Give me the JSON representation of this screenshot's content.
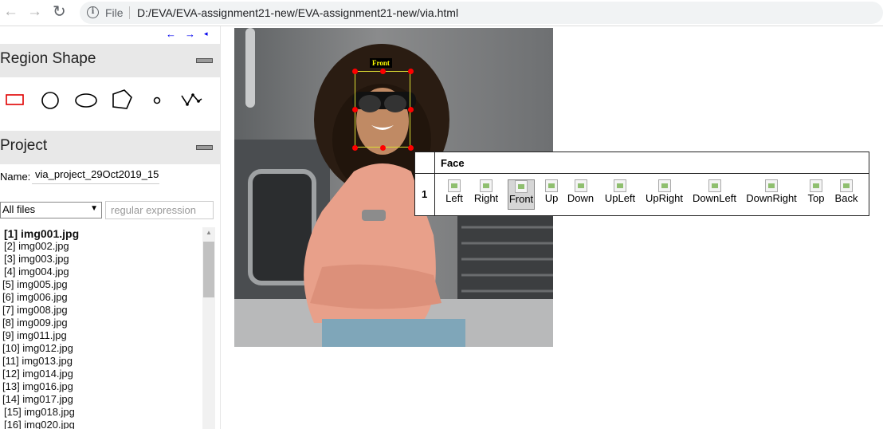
{
  "browser": {
    "file_label": "File",
    "url": "D:/EVA/EVA-assignment21-new/EVA-assignment21-new/via.html"
  },
  "left_panel": {
    "arrows": [
      "←",
      "→",
      "◂"
    ],
    "region_shape": {
      "title": "Region Shape",
      "shapes": [
        "rectangle",
        "circle",
        "ellipse",
        "polygon",
        "point",
        "polyline"
      ],
      "selected": "rectangle"
    },
    "project": {
      "title": "Project",
      "name_label": "Name:",
      "name_value": "via_project_29Oct2019_15",
      "filter_value": "All files",
      "regex_placeholder": "regular expression",
      "files": [
        "[1] img001.jpg",
        "[2] img002.jpg",
        "[3] img003.jpg",
        "[4] img004.jpg",
        "[5] img005.jpg",
        "[6] img006.jpg",
        "[7] img008.jpg",
        "[8] img009.jpg",
        "[9] img011.jpg",
        "[10] img012.jpg",
        "[11] img013.jpg",
        "[12] img014.jpg",
        "[13] img016.jpg",
        "[14] img017.jpg",
        "[15] img018.jpg",
        "[16] img020.jpg"
      ],
      "active_file_index": 0
    }
  },
  "canvas": {
    "region_label": "Front"
  },
  "attribute_editor": {
    "attribute_name": "Face",
    "row_id": "1",
    "options": [
      "Left",
      "Right",
      "Front",
      "Up",
      "Down",
      "UpLeft",
      "UpRight",
      "DownLeft",
      "DownRight",
      "Top",
      "Back"
    ],
    "selected": "Front"
  }
}
